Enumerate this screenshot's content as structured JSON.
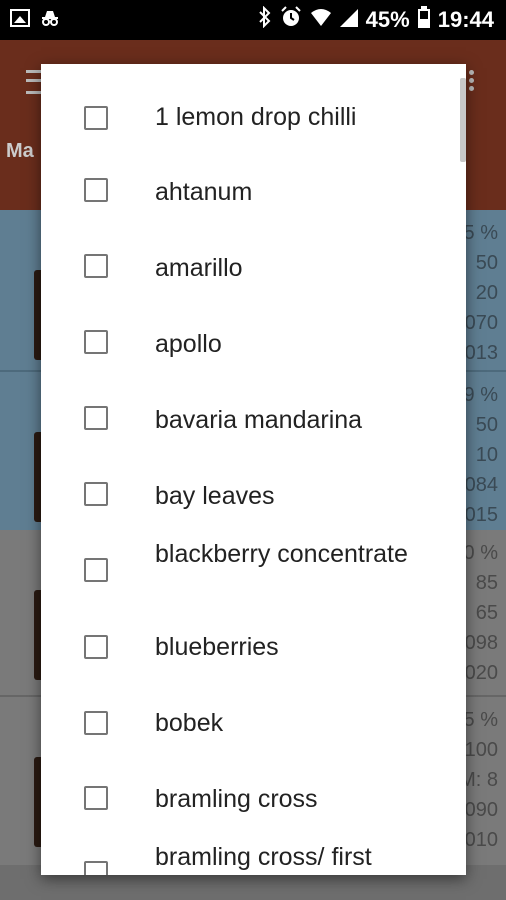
{
  "status_bar": {
    "battery": "45%",
    "time": "19:44",
    "icons_left": [
      "image-icon",
      "incognito-icon"
    ],
    "icons_right": [
      "bluetooth-icon",
      "alarm-icon",
      "wifi-icon",
      "signal-icon",
      "battery-icon"
    ]
  },
  "background": {
    "toolbar_color": "#6a2d1c",
    "tab_text": "Ma",
    "cards": [
      {
        "values": [
          "5 %",
          "50",
          "20",
          "070",
          "013"
        ]
      },
      {
        "values": [
          "9 %",
          "50",
          "10",
          "084",
          "015"
        ]
      },
      {
        "values": [
          "0 %",
          "85",
          "65",
          "098",
          "020"
        ]
      },
      {
        "values": [
          "5 %",
          "100",
          "M: 8",
          "090",
          "010"
        ]
      }
    ]
  },
  "dialog": {
    "options": [
      {
        "label": "1 lemon drop chilli",
        "checked": false
      },
      {
        "label": "ahtanum",
        "checked": false
      },
      {
        "label": "amarillo",
        "checked": false
      },
      {
        "label": "apollo",
        "checked": false
      },
      {
        "label": "bavaria mandarina",
        "checked": false
      },
      {
        "label": "bay leaves",
        "checked": false
      },
      {
        "label": "blackberry concentrate",
        "checked": false
      },
      {
        "label": "blueberries",
        "checked": false
      },
      {
        "label": "bobek",
        "checked": false
      },
      {
        "label": "bramling cross",
        "checked": false
      },
      {
        "label": "bramling cross/ first",
        "checked": false
      }
    ]
  }
}
